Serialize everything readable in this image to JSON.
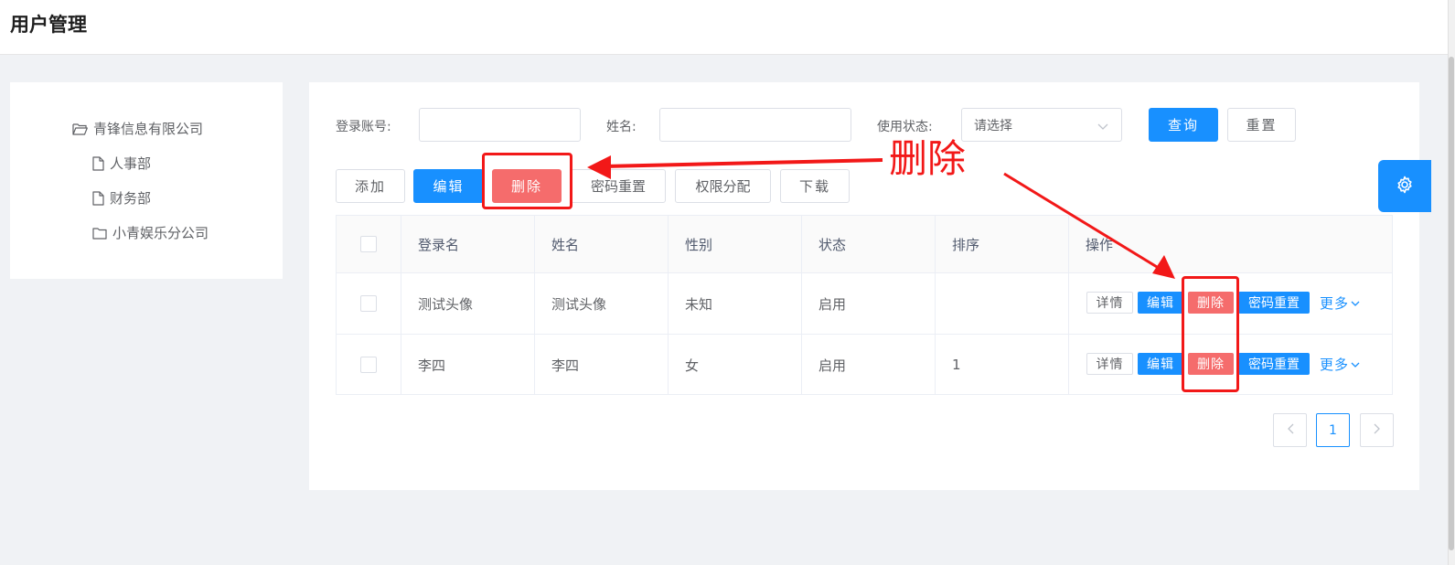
{
  "header": {
    "title": "用户管理"
  },
  "tree": {
    "root": "青锋信息有限公司",
    "children": [
      "人事部",
      "财务部",
      "小青娱乐分公司"
    ]
  },
  "search": {
    "login_label": "登录账号:",
    "login_value": "",
    "name_label": "姓名:",
    "name_value": "",
    "status_label": "使用状态:",
    "status_placeholder": "请选择",
    "query_btn": "查询",
    "reset_btn": "重置"
  },
  "toolbar": {
    "add": "添加",
    "edit": "编辑",
    "delete": "删除",
    "reset_password": "密码重置",
    "permission": "权限分配",
    "download": "下载"
  },
  "table": {
    "columns": [
      "登录名",
      "姓名",
      "性别",
      "状态",
      "排序",
      "操作"
    ],
    "rows": [
      {
        "login": "测试头像",
        "name": "测试头像",
        "gender": "未知",
        "status": "启用",
        "order": ""
      },
      {
        "login": "李四",
        "name": "李四",
        "gender": "女",
        "status": "启用",
        "order": "1"
      }
    ],
    "actions": {
      "detail": "详情",
      "edit": "编辑",
      "delete": "删除",
      "reset_password": "密码重置",
      "more": "更多"
    }
  },
  "pagination": {
    "current": "1"
  },
  "annotation": {
    "text": "删除",
    "color": "#f21818"
  },
  "colors": {
    "primary": "#1890ff",
    "danger": "#f56c6c"
  }
}
